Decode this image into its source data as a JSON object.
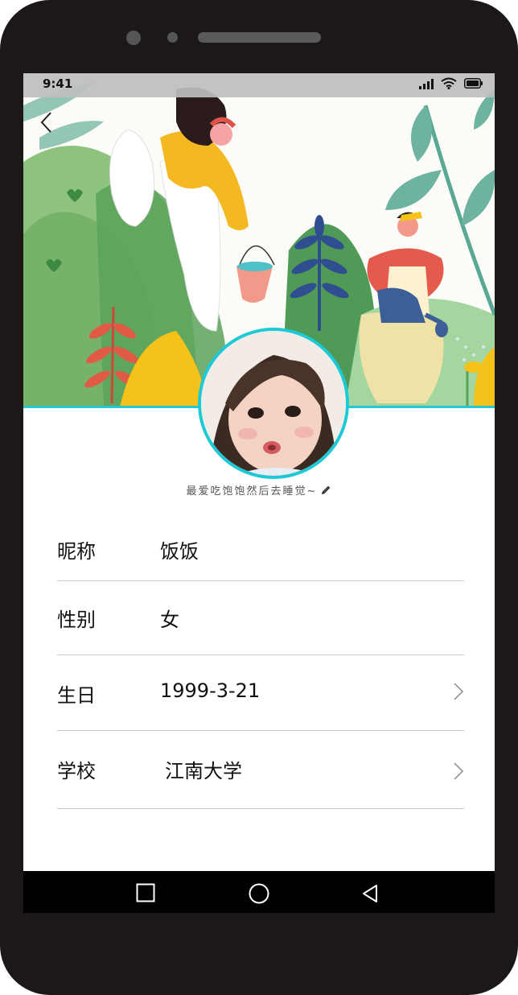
{
  "status_bar": {
    "time": "9:41",
    "icons": [
      "signal-icon",
      "wifi-icon",
      "battery-icon"
    ]
  },
  "header": {
    "back_icon": "chevron-left-icon"
  },
  "profile": {
    "signature": "最爱吃饱饱然后去睡觉~",
    "edit_icon": "pencil-icon"
  },
  "fields": [
    {
      "label": "昵称",
      "value": "饭饭"
    },
    {
      "label": "性别",
      "value": "女"
    },
    {
      "label": "生日",
      "value": "1999-3-21",
      "chevron": "chevron-right-icon"
    },
    {
      "label": "学校",
      "value": "江南大学",
      "chevron": "chevron-right-icon"
    }
  ],
  "nav_bar": {
    "icons": [
      "recents-square-icon",
      "home-circle-icon",
      "back-triangle-icon"
    ]
  },
  "colors": {
    "accent": "#1cc9d6",
    "divider": "#c8c8c8",
    "phone_frame": "#1c1818"
  }
}
